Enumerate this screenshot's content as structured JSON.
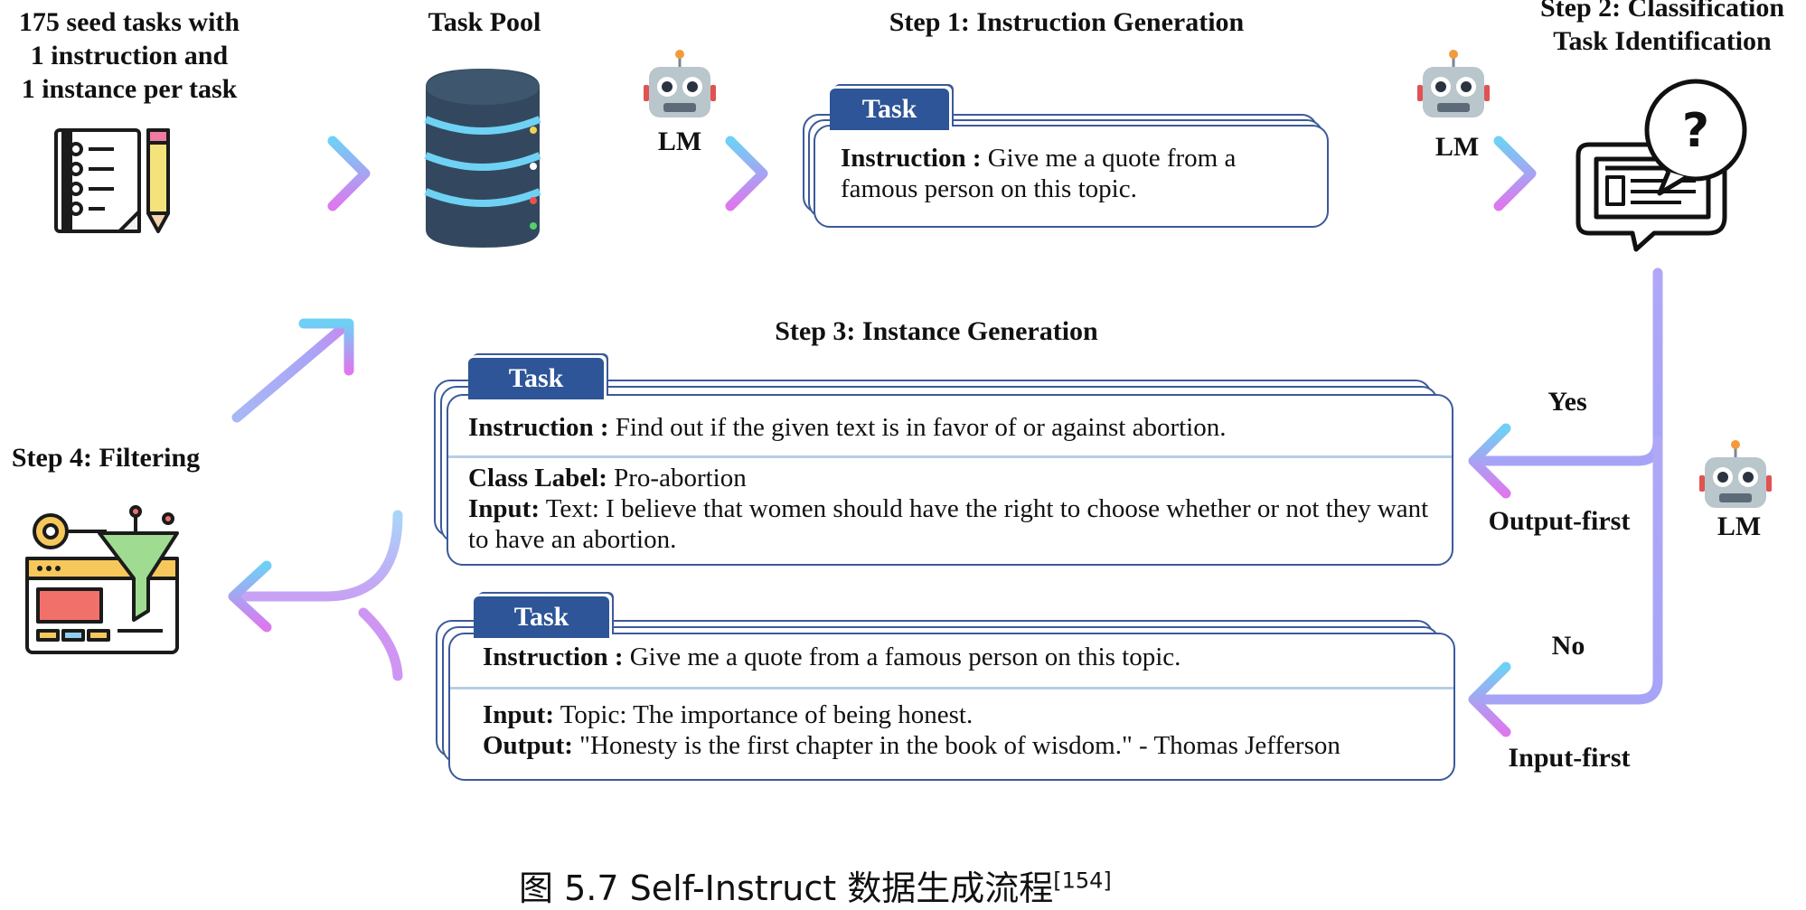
{
  "seed": {
    "line1": "175 seed tasks with",
    "line2": "1 instruction and",
    "line3": "1 instance per task"
  },
  "task_pool": {
    "title": "Task Pool"
  },
  "lm_label": "LM",
  "step1": {
    "title": "Step 1: Instruction Generation",
    "tab": "Task",
    "instruction_key": "Instruction :",
    "instruction_text": "Give me a quote from a famous person on this topic."
  },
  "step2": {
    "line1": "Step 2: Classification",
    "line2": "Task Identification"
  },
  "step3": {
    "title": "Step 3: Instance Generation"
  },
  "step4": {
    "title": "Step 4: Filtering"
  },
  "card_output_first": {
    "tab": "Task",
    "instruction_key": "Instruction :",
    "instruction_text": "Find out if the given text is in favor of or against abortion.",
    "class_key": "Class Label:",
    "class_value": "Pro-abortion",
    "input_key": "Input:",
    "input_text": "Text: I believe that women should have the right to choose whether or not they want to have an abortion."
  },
  "card_input_first": {
    "tab": "Task",
    "instruction_key": "Instruction :",
    "instruction_text": "Give me a quote from a famous person on this topic.",
    "input_key": "Input:",
    "input_text": "Topic: The importance of being honest.",
    "output_key": "Output:",
    "output_text": "\"Honesty is the first chapter in the book of wisdom.\" - Thomas Jefferson"
  },
  "branches": {
    "yes": "Yes",
    "output_first": "Output-first",
    "no": "No",
    "input_first": "Input-first"
  },
  "caption": {
    "text": "图 5.7    Self-Instruct 数据生成流程",
    "ref": "[154]"
  },
  "icons": [
    "checklist-icon",
    "database-icon",
    "robot-icon",
    "classification-monitor-icon",
    "filter-funnel-icon"
  ],
  "colors": {
    "arrow_start": "#7fd3f7",
    "arrow_mid": "#a9a6f7",
    "arrow_end": "#d77cf0",
    "tab_bg": "#2d5597",
    "card_border": "#3b5a9a",
    "divider": "#b5cfe6"
  }
}
